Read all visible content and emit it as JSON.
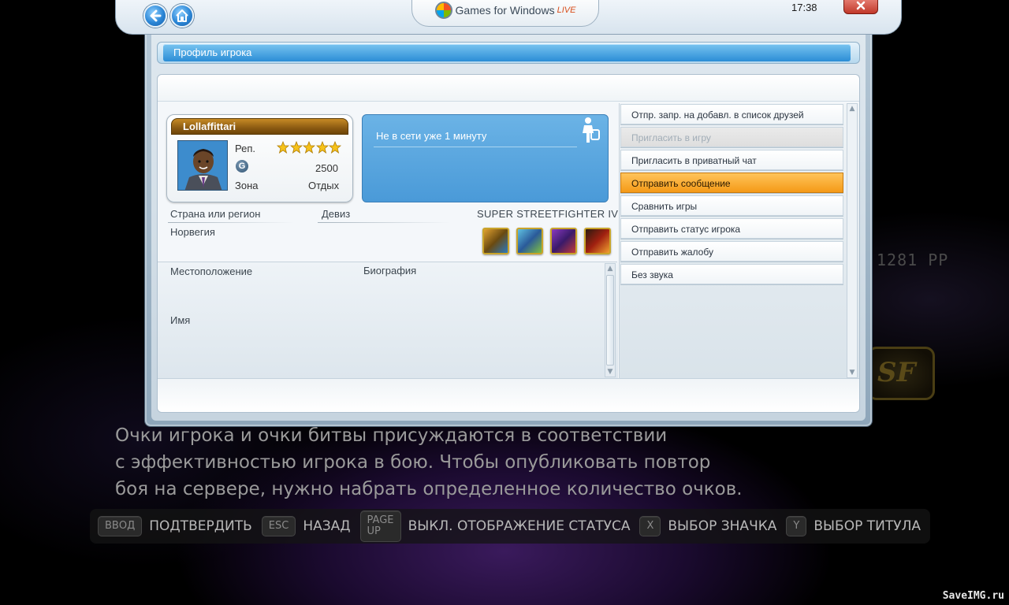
{
  "background": {
    "score_text": "1281 PP",
    "tip_lines": [
      "Очки игрока и очки битвы присуждаются в соответствии",
      "с эффективностью игрока в бою. Чтобы опубликовать повтор",
      "боя на сервере, нужно набрать определенное количество очков."
    ],
    "buttons": [
      {
        "key": "ВВОД",
        "label": "ПОДТВЕРДИТЬ"
      },
      {
        "key": "ESC",
        "label": "НАЗАД"
      },
      {
        "key": "PAGE UP",
        "label": "ВЫКЛ. ОТОБРАЖЕНИЕ СТАТУСА"
      },
      {
        "key": "X",
        "label": "ВЫБОР ЗНАЧКА"
      },
      {
        "key": "Y",
        "label": "ВЫБОР ТИТУЛА"
      }
    ],
    "watermark": "SaveIMG.ru"
  },
  "gfw": {
    "brand": "Games for Windows",
    "live": "LIVE",
    "time": "17:38"
  },
  "window": {
    "title": "Профиль игрока"
  },
  "gamercard": {
    "gamertag": "Lollaffittari",
    "rep_label": "Реп.",
    "rep_stars": 5,
    "gamerscore": "2500",
    "zone_label": "Зона",
    "zone_value": "Отдых"
  },
  "status": {
    "text": "Не в сети уже 1 минуту"
  },
  "profile": {
    "country_label": "Страна или регион",
    "country_value": "Норвегия",
    "motto_label": "Девиз",
    "game_title": "SUPER STREETFIGHTER IV",
    "location_label": "Местоположение",
    "bio_label": "Биография",
    "name_label": "Имя"
  },
  "menu": {
    "items": [
      {
        "label": "Отпр. запр. на добавл. в список друзей",
        "state": "normal"
      },
      {
        "label": "Пригласить в игру",
        "state": "disabled"
      },
      {
        "label": "Пригласить в приватный чат",
        "state": "normal"
      },
      {
        "label": "Отправить сообщение",
        "state": "selected"
      },
      {
        "label": "Сравнить игры",
        "state": "normal"
      },
      {
        "label": "Отправить статус игрока",
        "state": "normal"
      },
      {
        "label": "Отправить жалобу",
        "state": "normal"
      },
      {
        "label": "Без звука",
        "state": "normal"
      }
    ]
  },
  "colors": {
    "accent_blue": "#4a9ad8",
    "selected_orange": "#f59a17",
    "gamertag_gold": "#8b5a12"
  }
}
